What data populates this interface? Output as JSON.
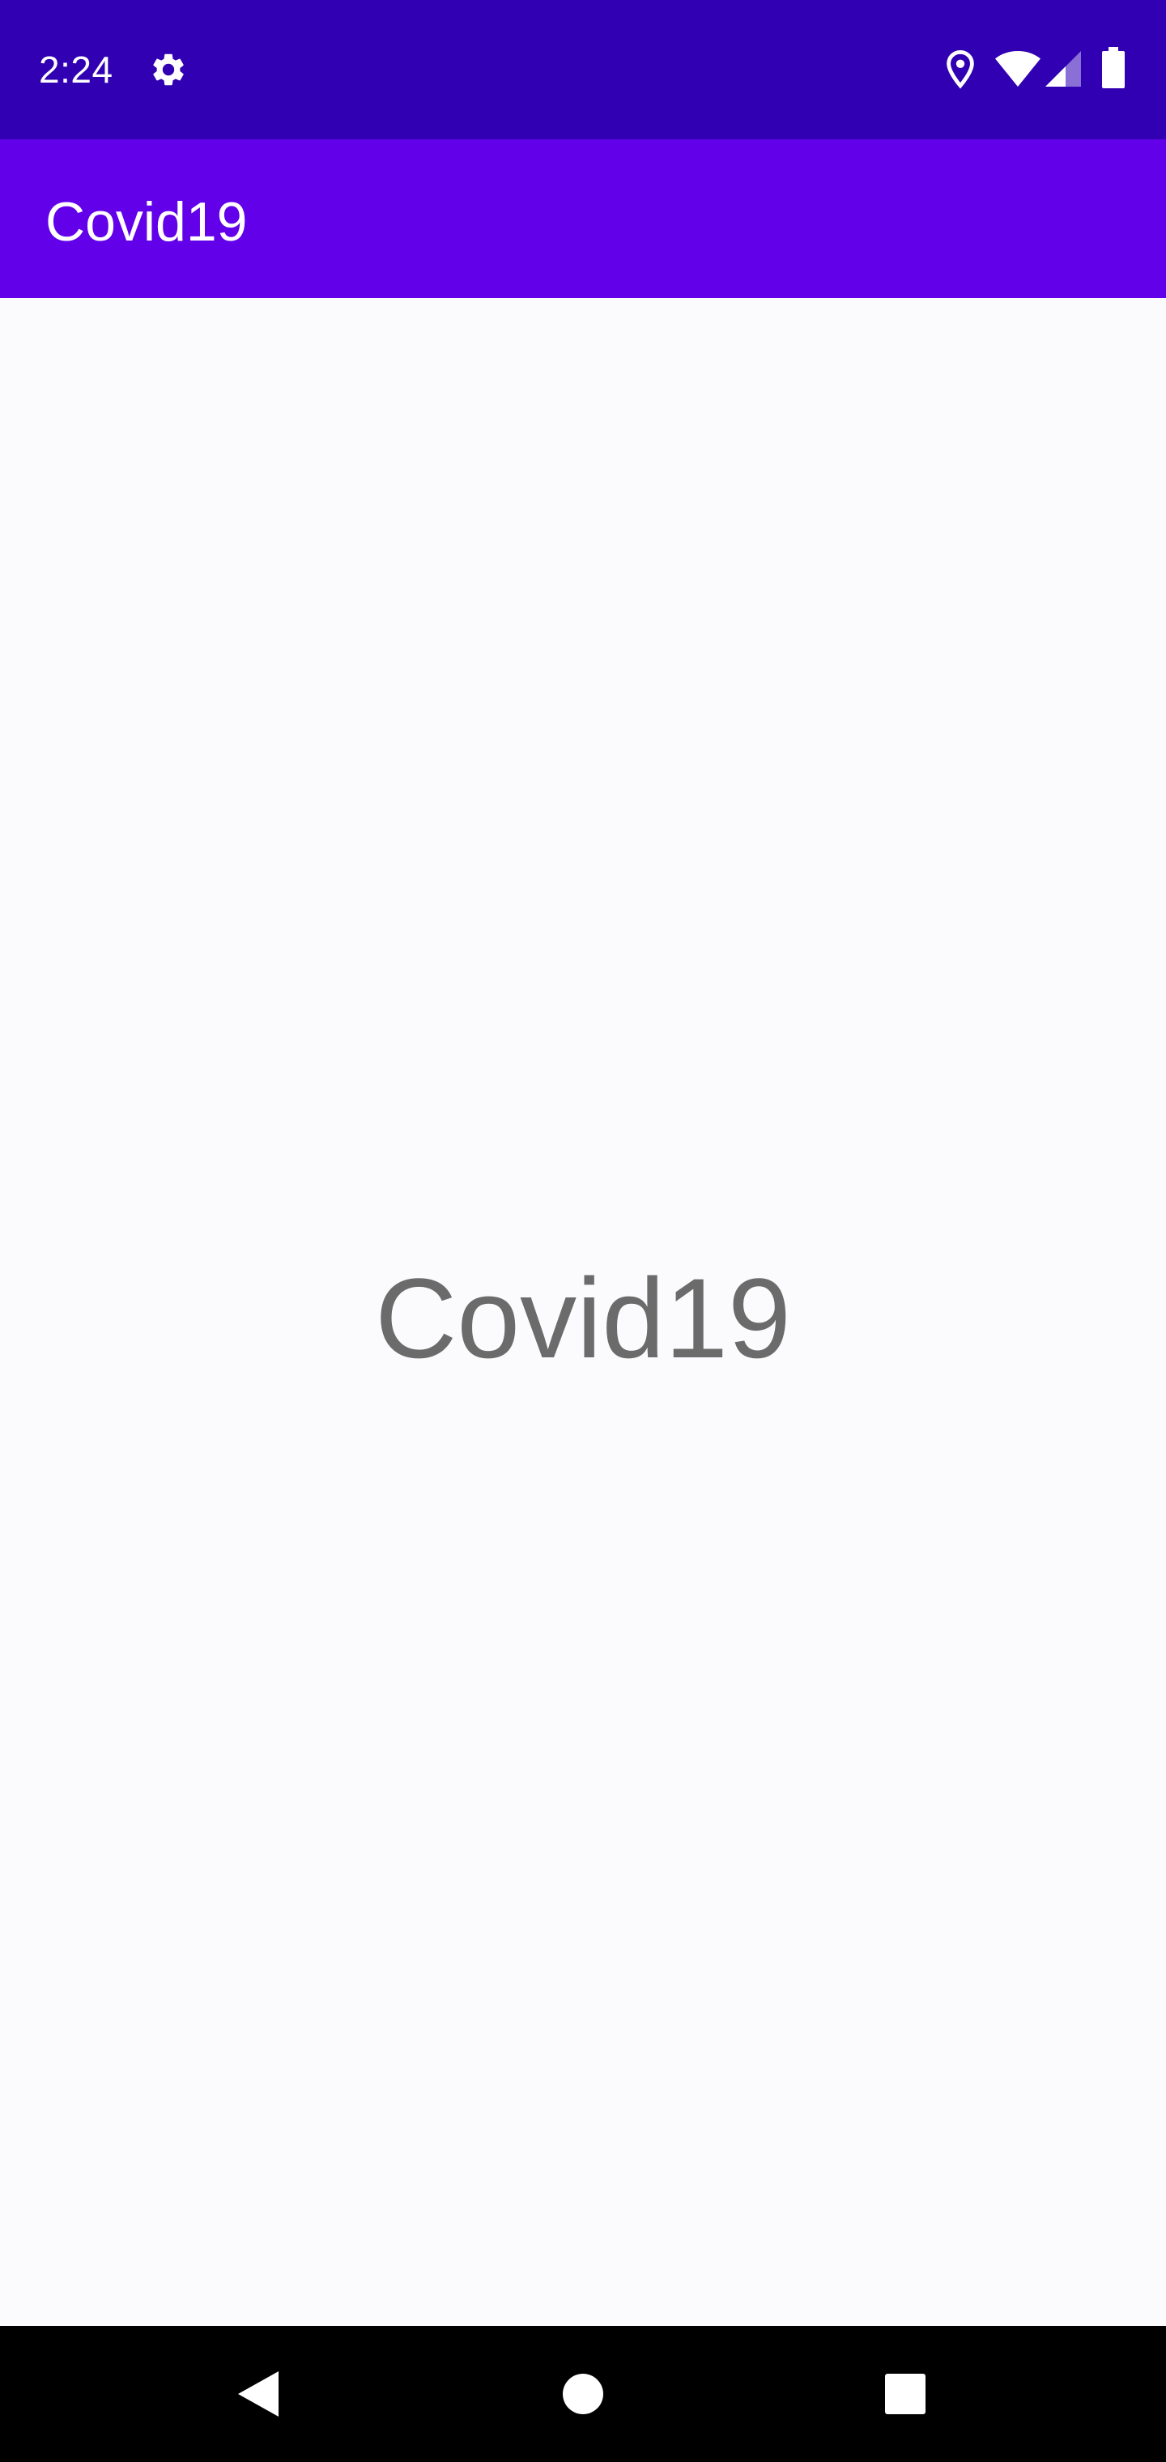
{
  "status_bar": {
    "time": "2:24",
    "icons": [
      "gear-icon",
      "location-icon",
      "wifi-icon",
      "cell-signal-icon",
      "battery-icon"
    ],
    "background": "#3100b3"
  },
  "app_bar": {
    "title": "Covid19",
    "background": "#6200ea"
  },
  "main": {
    "center_text": "Covid19",
    "text_color": "#6b6b6b",
    "background": "#fbfafd"
  },
  "nav_bar": {
    "buttons": [
      "back-icon",
      "home-icon",
      "recents-icon"
    ]
  }
}
